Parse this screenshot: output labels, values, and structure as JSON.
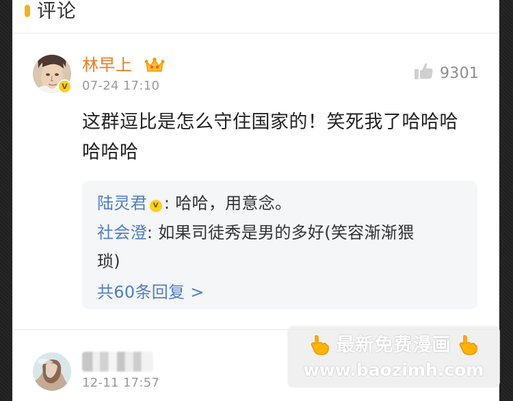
{
  "header": {
    "title": "评论"
  },
  "comments": [
    {
      "user_name": "林早上",
      "timestamp": "07-24 17:10",
      "like_count": "9301",
      "text": "这群逗比是怎么守住国家的！笑死我了哈哈哈哈哈哈",
      "replies": [
        {
          "author": "陆灵君",
          "text": ": 哈哈，用意念。"
        },
        {
          "author": "社会澄",
          "text": ": 如果司徒秀是男的多好(笑容渐渐猥"
        },
        {
          "author": "",
          "text": "琐)"
        }
      ],
      "more_replies": "共60条回复 >"
    },
    {
      "timestamp": "12-11 17:57"
    }
  ],
  "watermark": {
    "line1": "最新免费漫画",
    "line2": "www.baozimh.com"
  },
  "icons": {
    "header_marker": "header-marker-icon",
    "crown": "crown-icon",
    "verified": "verified-icon",
    "like": "thumbs-up-icon",
    "hand": "pointing-down-icon"
  },
  "colors": {
    "accent": "#f2b01e",
    "username": "#e67e22",
    "link": "#4f7ec6",
    "badge": "#ffcf1a",
    "muted": "#9a9a9a"
  }
}
